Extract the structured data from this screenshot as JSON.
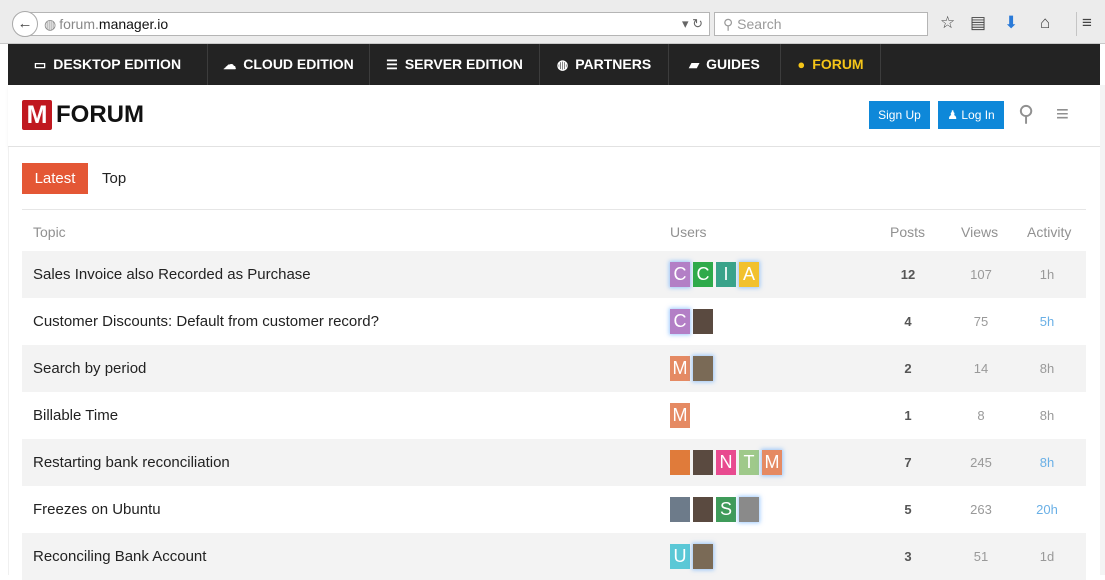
{
  "browser": {
    "url_prefix": "forum.",
    "url_host": "manager.io",
    "search_placeholder": "Search",
    "back_icon": "back-arrow-icon",
    "reload_icon": "reload-icon"
  },
  "site_nav": [
    {
      "icon": "laptop-icon",
      "glyph": "▭",
      "label": "DESKTOP EDITION",
      "active": false
    },
    {
      "icon": "cloud-icon",
      "glyph": "☁",
      "label": "CLOUD EDITION",
      "active": false
    },
    {
      "icon": "server-icon",
      "glyph": "☰",
      "label": "SERVER EDITION",
      "active": false
    },
    {
      "icon": "globe-icon",
      "glyph": "◍",
      "label": "PARTNERS",
      "active": false
    },
    {
      "icon": "book-icon",
      "glyph": "▰",
      "label": "GUIDES",
      "active": false
    },
    {
      "icon": "comment-icon",
      "glyph": "●",
      "label": "FORUM",
      "active": true
    }
  ],
  "forum": {
    "logo_letter": "M",
    "logo_text": "FORUM",
    "signup_label": "Sign Up",
    "login_label": "Log In",
    "tabs": {
      "latest": "Latest",
      "top": "Top"
    }
  },
  "columns": {
    "topic": "Topic",
    "users": "Users",
    "posts": "Posts",
    "views": "Views",
    "activity": "Activity"
  },
  "colors": {
    "accent": "#e45735",
    "nav_bg": "#232323",
    "nav_active": "#f5c518",
    "button_blue": "#0e88d9",
    "logo_red": "#c0181f",
    "recent_activity": "#6ab0e6"
  },
  "topics": [
    {
      "title": "Sales Invoice also Recorded as Purchase",
      "users": [
        {
          "letter": "C",
          "color": "#b37fc6",
          "glow": true
        },
        {
          "letter": "C",
          "color": "#2eaa4a",
          "glow": false
        },
        {
          "letter": "I",
          "color": "#3aa38a",
          "glow": false
        },
        {
          "letter": "A",
          "color": "#f2c12e",
          "glow": true
        }
      ],
      "posts": "12",
      "views": "107",
      "activity": "1h",
      "recent": false
    },
    {
      "title": "Customer Discounts: Default from customer record?",
      "users": [
        {
          "letter": "C",
          "color": "#b37fc6",
          "glow": true
        },
        {
          "letter": "",
          "photo": "p1",
          "glow": false
        }
      ],
      "posts": "4",
      "views": "75",
      "activity": "5h",
      "recent": true
    },
    {
      "title": "Search by period",
      "users": [
        {
          "letter": "M",
          "color": "#e58a63",
          "glow": false
        },
        {
          "letter": "",
          "photo": "p2",
          "glow": true
        }
      ],
      "posts": "2",
      "views": "14",
      "activity": "8h",
      "recent": false
    },
    {
      "title": "Billable Time",
      "users": [
        {
          "letter": "M",
          "color": "#e58a63",
          "glow": false
        }
      ],
      "posts": "1",
      "views": "8",
      "activity": "8h",
      "recent": false
    },
    {
      "title": "Restarting bank reconciliation",
      "users": [
        {
          "letter": "",
          "photo": "p5",
          "glow": false
        },
        {
          "letter": "",
          "photo": "p1",
          "glow": false
        },
        {
          "letter": "N",
          "color": "#e84a8f",
          "glow": false
        },
        {
          "letter": "T",
          "color": "#9fc98a",
          "glow": false
        },
        {
          "letter": "M",
          "color": "#e58a63",
          "glow": true
        }
      ],
      "posts": "7",
      "views": "245",
      "activity": "8h",
      "recent": true
    },
    {
      "title": "Freezes on Ubuntu",
      "users": [
        {
          "letter": "",
          "photo": "p4",
          "glow": false
        },
        {
          "letter": "",
          "photo": "p1",
          "glow": false
        },
        {
          "letter": "S",
          "color": "#3f9b5a",
          "glow": false
        },
        {
          "letter": "",
          "photo": "p3",
          "glow": true
        }
      ],
      "posts": "5",
      "views": "263",
      "activity": "20h",
      "recent": true
    },
    {
      "title": "Reconciling Bank Account",
      "users": [
        {
          "letter": "U",
          "color": "#5bc8d6",
          "glow": false
        },
        {
          "letter": "",
          "photo": "p2",
          "glow": true
        }
      ],
      "posts": "3",
      "views": "51",
      "activity": "1d",
      "recent": false
    }
  ]
}
